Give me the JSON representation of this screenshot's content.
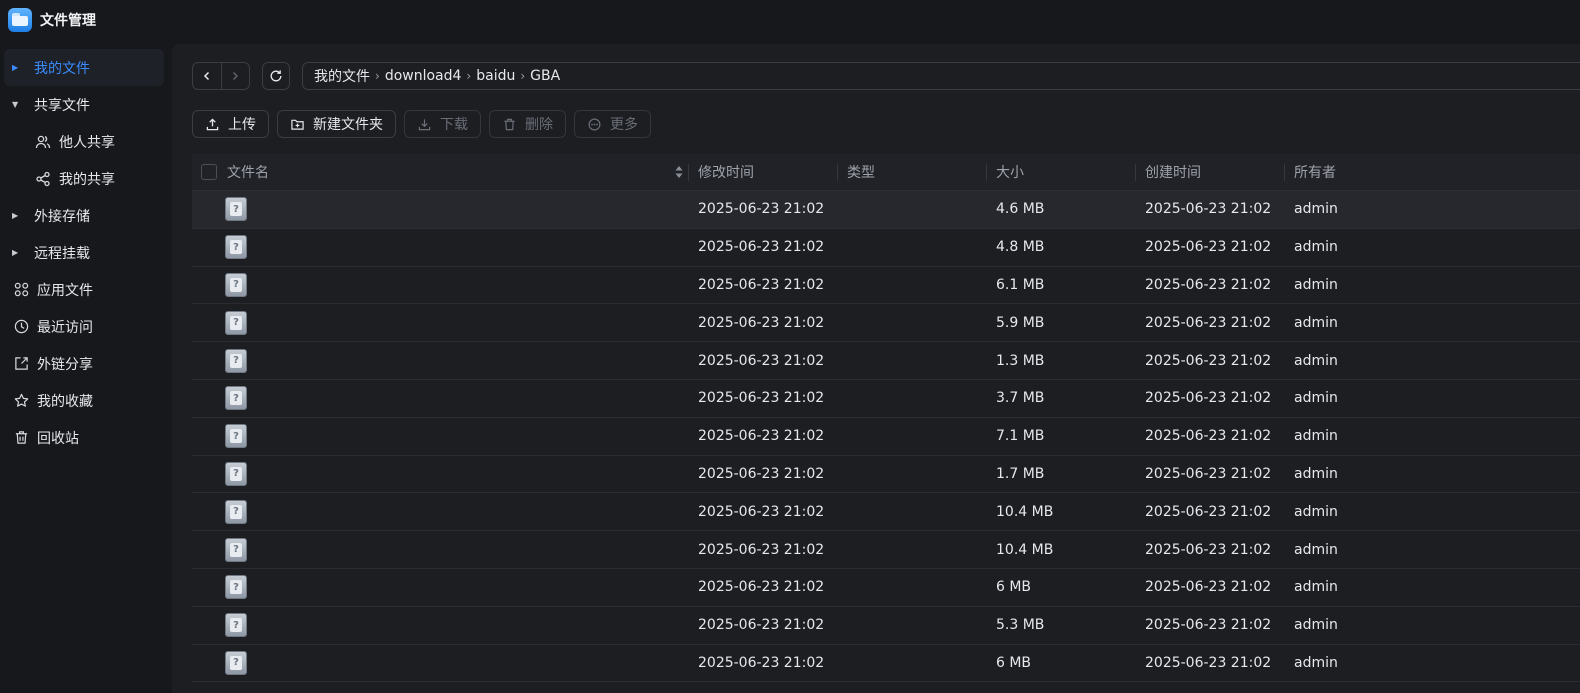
{
  "app": {
    "title": "文件管理",
    "icon": "folder-app-icon"
  },
  "sidebar": {
    "items": [
      {
        "label": "我的文件",
        "icon": "caret-right-icon",
        "active": true
      },
      {
        "label": "共享文件",
        "icon": "caret-down-icon"
      },
      {
        "label": "他人共享",
        "icon": "users-icon",
        "sub": true
      },
      {
        "label": "我的共享",
        "icon": "share-nodes-icon",
        "sub": true
      },
      {
        "label": "外接存储",
        "icon": "caret-right-icon"
      },
      {
        "label": "远程挂载",
        "icon": "caret-right-icon"
      },
      {
        "label": "应用文件",
        "icon": "apps-grid-icon"
      },
      {
        "label": "最近访问",
        "icon": "clock-icon"
      },
      {
        "label": "外链分享",
        "icon": "external-share-icon"
      },
      {
        "label": "我的收藏",
        "icon": "star-icon"
      },
      {
        "label": "回收站",
        "icon": "trash-icon"
      }
    ]
  },
  "breadcrumb": [
    "我的文件",
    "download4",
    "baidu",
    "GBA"
  ],
  "toolbar": {
    "upload": "上传",
    "new_folder": "新建文件夹",
    "download": "下载",
    "delete": "删除",
    "more": "更多"
  },
  "table": {
    "headers": {
      "name": "文件名",
      "modified": "修改时间",
      "type": "类型",
      "size": "大小",
      "created": "创建时间",
      "owner": "所有者"
    },
    "rows": [
      {
        "modified": "2025-06-23 21:02",
        "type": "",
        "size": "4.6 MB",
        "created": "2025-06-23 21:02",
        "owner": "admin"
      },
      {
        "modified": "2025-06-23 21:02",
        "type": "",
        "size": "4.8 MB",
        "created": "2025-06-23 21:02",
        "owner": "admin"
      },
      {
        "modified": "2025-06-23 21:02",
        "type": "",
        "size": "6.1 MB",
        "created": "2025-06-23 21:02",
        "owner": "admin"
      },
      {
        "modified": "2025-06-23 21:02",
        "type": "",
        "size": "5.9 MB",
        "created": "2025-06-23 21:02",
        "owner": "admin"
      },
      {
        "modified": "2025-06-23 21:02",
        "type": "",
        "size": "1.3 MB",
        "created": "2025-06-23 21:02",
        "owner": "admin"
      },
      {
        "modified": "2025-06-23 21:02",
        "type": "",
        "size": "3.7 MB",
        "created": "2025-06-23 21:02",
        "owner": "admin"
      },
      {
        "modified": "2025-06-23 21:02",
        "type": "",
        "size": "7.1 MB",
        "created": "2025-06-23 21:02",
        "owner": "admin"
      },
      {
        "modified": "2025-06-23 21:02",
        "type": "",
        "size": "1.7 MB",
        "created": "2025-06-23 21:02",
        "owner": "admin"
      },
      {
        "modified": "2025-06-23 21:02",
        "type": "",
        "size": "10.4 MB",
        "created": "2025-06-23 21:02",
        "owner": "admin"
      },
      {
        "modified": "2025-06-23 21:02",
        "type": "",
        "size": "10.4 MB",
        "created": "2025-06-23 21:02",
        "owner": "admin"
      },
      {
        "modified": "2025-06-23 21:02",
        "type": "",
        "size": "6 MB",
        "created": "2025-06-23 21:02",
        "owner": "admin"
      },
      {
        "modified": "2025-06-23 21:02",
        "type": "",
        "size": "5.3 MB",
        "created": "2025-06-23 21:02",
        "owner": "admin"
      },
      {
        "modified": "2025-06-23 21:02",
        "type": "",
        "size": "6 MB",
        "created": "2025-06-23 21:02",
        "owner": "admin"
      }
    ]
  },
  "colors": {
    "accent": "#3b8cff",
    "background": "#17181c",
    "panel": "#1c1e22"
  }
}
